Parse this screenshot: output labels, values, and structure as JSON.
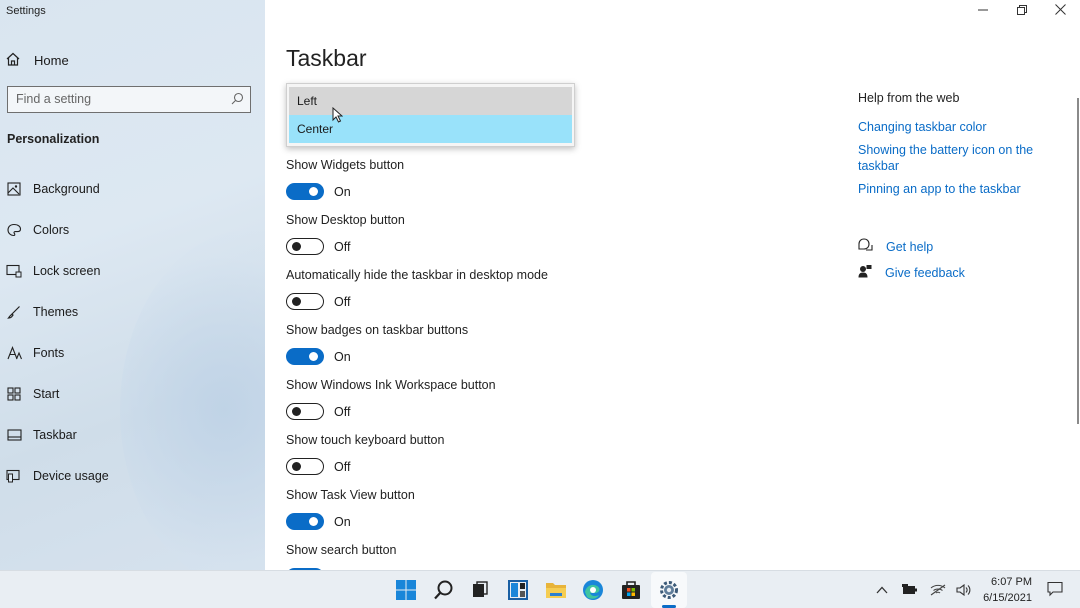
{
  "window": {
    "app_title": "Settings",
    "controls": [
      {
        "name": "minimize-button",
        "icon": "minimize-icon"
      },
      {
        "name": "restore-button",
        "icon": "restore-icon"
      },
      {
        "name": "close-button",
        "icon": "close-icon"
      }
    ]
  },
  "sidebar": {
    "home_label": "Home",
    "search_placeholder": "Find a setting",
    "section_title": "Personalization",
    "items": [
      {
        "label": "Background",
        "icon": "picture-icon"
      },
      {
        "label": "Colors",
        "icon": "palette-icon"
      },
      {
        "label": "Lock screen",
        "icon": "lock-screen-icon"
      },
      {
        "label": "Themes",
        "icon": "brush-icon"
      },
      {
        "label": "Fonts",
        "icon": "fonts-icon"
      },
      {
        "label": "Start",
        "icon": "start-grid-icon"
      },
      {
        "label": "Taskbar",
        "icon": "taskbar-icon"
      },
      {
        "label": "Device usage",
        "icon": "device-usage-icon"
      }
    ]
  },
  "main": {
    "title": "Taskbar",
    "dropdown": {
      "options": [
        "Left",
        "Center"
      ],
      "hovered": "Left",
      "selected": "Center"
    },
    "settings": [
      {
        "label": "Show Widgets button",
        "state": "On"
      },
      {
        "label": "Show Desktop button",
        "state": "Off"
      },
      {
        "label": "Automatically hide the taskbar in desktop mode",
        "state": "Off"
      },
      {
        "label": "Show badges on taskbar buttons",
        "state": "On"
      },
      {
        "label": "Show Windows Ink Workspace button",
        "state": "Off"
      },
      {
        "label": "Show touch keyboard button",
        "state": "Off"
      },
      {
        "label": "Show Task View button",
        "state": "On"
      },
      {
        "label": "Show search button",
        "state": ""
      }
    ]
  },
  "help": {
    "title": "Help from the web",
    "links": [
      "Changing taskbar color",
      "Showing the battery icon on the taskbar",
      "Pinning an app to the taskbar"
    ],
    "get_help": "Get help",
    "give_feedback": "Give feedback"
  },
  "taskbar": {
    "apps": [
      "windows-start-icon",
      "search-icon",
      "task-view-icon",
      "widgets-icon",
      "file-explorer-icon",
      "edge-icon",
      "store-icon",
      "settings-gear-icon"
    ],
    "active_app": "settings-gear-icon",
    "tray_icons": [
      "chevron-up-icon",
      "battery-icon",
      "wifi-icon",
      "volume-icon"
    ],
    "time": "6:07 PM",
    "date": "6/15/2021"
  },
  "colors": {
    "accent": "#0a6cc7",
    "selected_option": "#99e2fa",
    "hover_option": "#d6d6d6",
    "sidebar_bg": "#dde8f2"
  }
}
